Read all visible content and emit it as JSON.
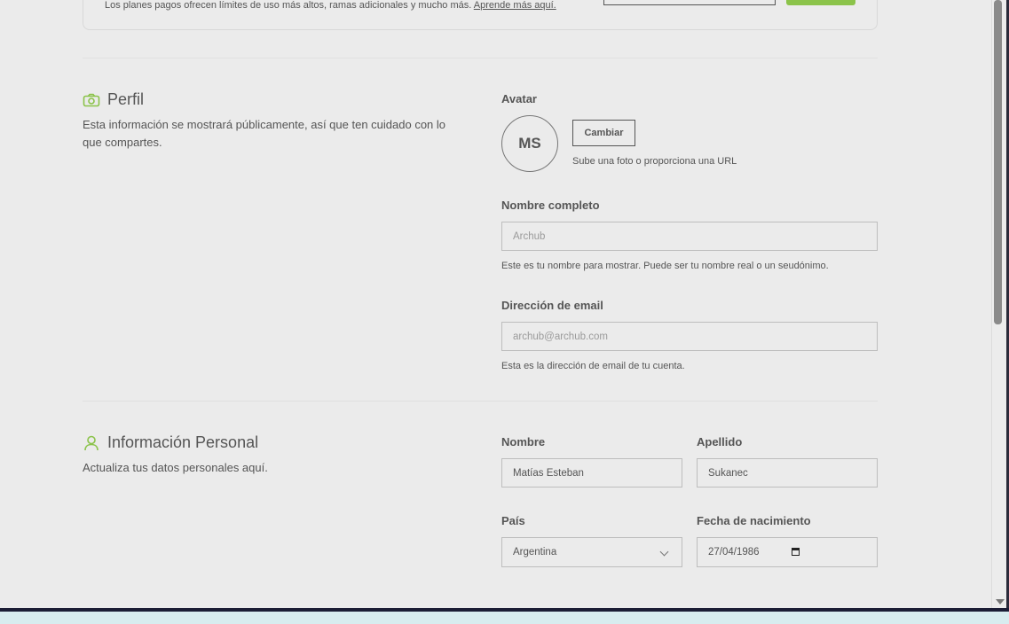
{
  "top_card": {
    "text": "Los planes pagos ofrecen límites de uso más altos, ramas adicionales y mucho más.",
    "link": "Aprende más aquí."
  },
  "profile": {
    "title": "Perfil",
    "description": "Esta información se mostrará públicamente, así que ten cuidado con lo que compartes.",
    "avatar_label": "Avatar",
    "avatar_initials": "MS",
    "change_button": "Cambiar",
    "avatar_help": "Sube una foto o proporciona una URL",
    "full_name_label": "Nombre completo",
    "full_name_placeholder": "Archub",
    "full_name_help": "Este es tu nombre para mostrar. Puede ser tu nombre real o un seudónimo.",
    "email_label": "Dirección de email",
    "email_placeholder": "archub@archub.com",
    "email_help": "Esta es la dirección de email de tu cuenta."
  },
  "personal": {
    "title": "Información Personal",
    "description": "Actualiza tus datos personales aquí.",
    "first_name_label": "Nombre",
    "first_name_value": "Matías Esteban",
    "last_name_label": "Apellido",
    "last_name_value": "Sukanec",
    "country_label": "País",
    "country_value": "Argentina",
    "birthdate_label": "Fecha de nacimiento",
    "birthdate_value": "27/04/1986"
  },
  "colors": {
    "accent": "#8bc34a",
    "background": "#ebebeb"
  },
  "icons": {
    "profile": "camera-icon",
    "personal": "user-icon",
    "select": "chevron-down-icon",
    "date": "calendar-icon"
  }
}
